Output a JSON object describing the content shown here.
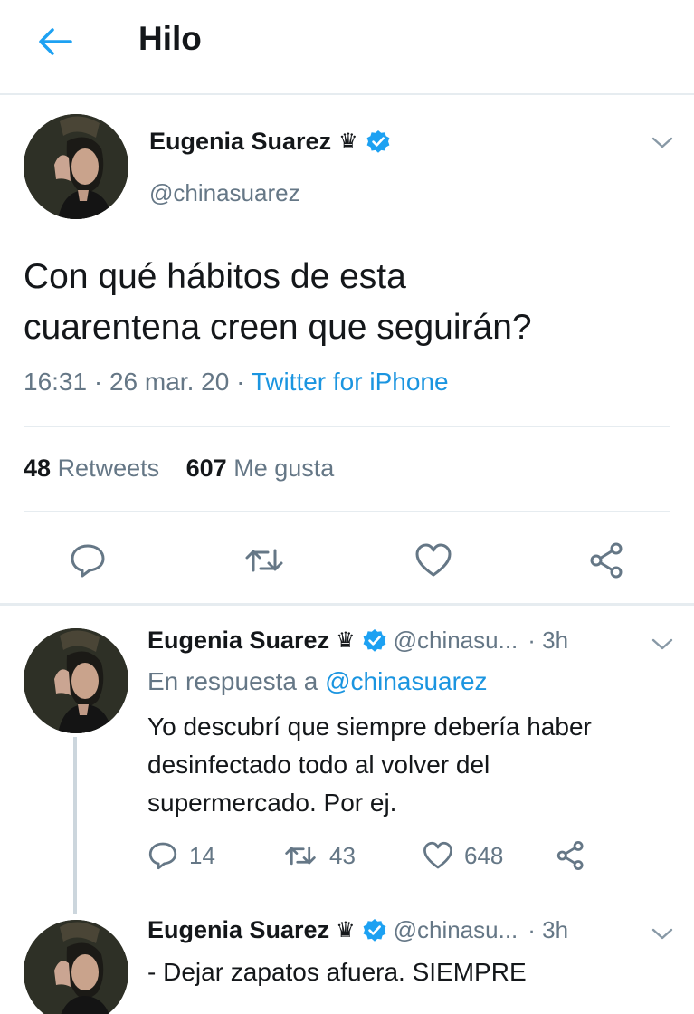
{
  "header": {
    "title": "Hilo"
  },
  "main_tweet": {
    "author_name": "Eugenia Suarez",
    "crown_glyph": "♛",
    "handle": "@chinasuarez",
    "text_line1": "Con qué hábitos de esta",
    "text_line2": "cuarentena creen que seguirán?",
    "time": "16:31",
    "date": "26 mar. 20",
    "source": "Twitter for iPhone",
    "retweets_count": "48",
    "retweets_label": "Retweets",
    "likes_count": "607",
    "likes_label": "Me gusta"
  },
  "replies": [
    {
      "author_name": "Eugenia Suarez",
      "crown_glyph": "♛",
      "handle": "@chinasu...",
      "age": "· 3h",
      "reply_prefix": "En respuesta a",
      "reply_handle": "@chinasuarez",
      "text_line1": "Yo descubrí que siempre debería haber",
      "text_line2": "desinfectado todo al volver del",
      "text_line3": "supermercado. Por ej.",
      "replies_count": "14",
      "retweets_count": "43",
      "likes_count": "648"
    },
    {
      "author_name": "Eugenia Suarez",
      "crown_glyph": "♛",
      "handle": "@chinasu...",
      "age": "· 3h",
      "text_line1": "- Dejar zapatos afuera. SIEMPRE"
    }
  ],
  "colors": {
    "accent": "#1da1f2",
    "link": "#1b95e0",
    "secondary_text": "#657786",
    "divider": "#e6ecf0"
  },
  "icons": [
    "back-arrow-icon",
    "verified-badge-icon",
    "crown-icon",
    "chevron-down-icon",
    "reply-icon",
    "retweet-icon",
    "like-icon",
    "share-icon"
  ]
}
